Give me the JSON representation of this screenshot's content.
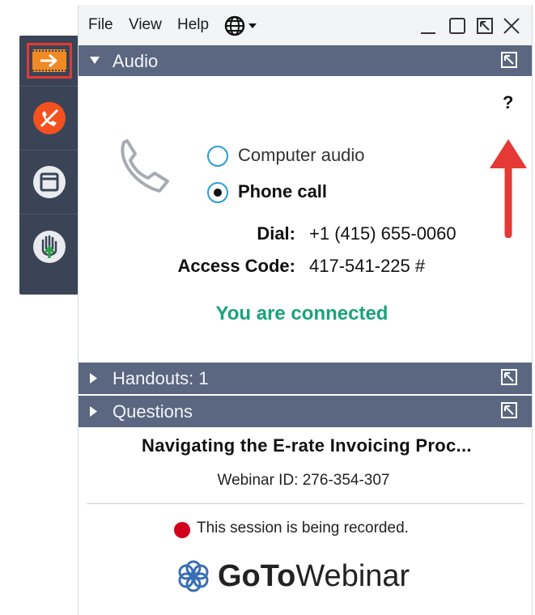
{
  "menu": {
    "file": "File",
    "view": "View",
    "help": "Help"
  },
  "audio_panel": {
    "title": "Audio",
    "help": "?",
    "options": {
      "computer": "Computer audio",
      "phone": "Phone call"
    },
    "selected": "phone",
    "dial_label": "Dial:",
    "dial_value": "+1 (415) 655-0060",
    "access_label": "Access Code:",
    "access_value": "417-541-225 #",
    "status": "You are connected"
  },
  "handouts": {
    "title": "Handouts: 1"
  },
  "questions": {
    "title": "Questions"
  },
  "session": {
    "title": "Navigating the E-rate Invoicing Proc...",
    "webinar_id": "Webinar ID: 276-354-307",
    "recording": "This session is being recorded.",
    "logo_bold": "GoTo",
    "logo_light": "Webinar"
  },
  "colors": {
    "toolbar": "#3a4456",
    "panel": "#5b6780",
    "status": "#1aa37a",
    "accent": "#f08a24",
    "highlight": "#e53935"
  }
}
